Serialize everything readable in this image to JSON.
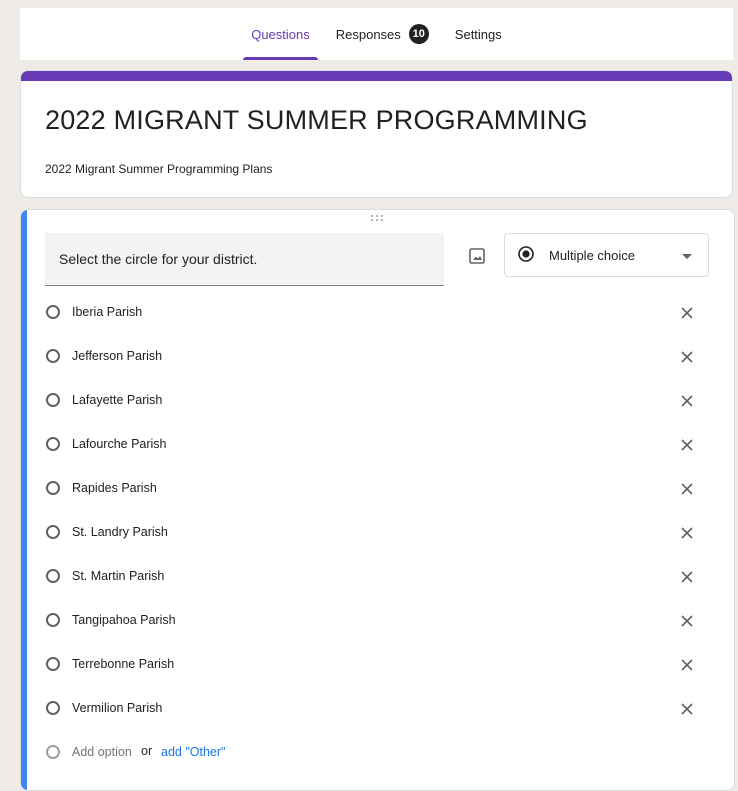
{
  "tabs": {
    "questions": "Questions",
    "responses": "Responses",
    "responses_count": "10",
    "settings": "Settings"
  },
  "form": {
    "title": "2022 MIGRANT SUMMER PROGRAMMING",
    "description": "2022 Migrant Summer Programming Plans"
  },
  "question": {
    "text": "Select the circle for your district.",
    "type": "Multiple choice",
    "options": [
      "Iberia Parish",
      "Jefferson Parish",
      "Lafayette Parish",
      "Lafourche Parish",
      "Rapides Parish",
      "St. Landry Parish",
      "St. Martin Parish",
      "Tangipahoa Parish",
      "Terrebonne Parish",
      "Vermilion Parish"
    ],
    "add_option": "Add option",
    "or": "or",
    "add_other": "add \"Other\""
  },
  "colors": {
    "accent": "#673ab7",
    "active_question": "#4285f4",
    "link": "#1a73e8",
    "page_background": "#efebe6"
  },
  "icons": {
    "image": "image-icon",
    "remove": "close-icon",
    "type_radio": "radio-selected-icon",
    "dropdown": "caret-down-icon",
    "drag": "drag-handle-icon"
  }
}
